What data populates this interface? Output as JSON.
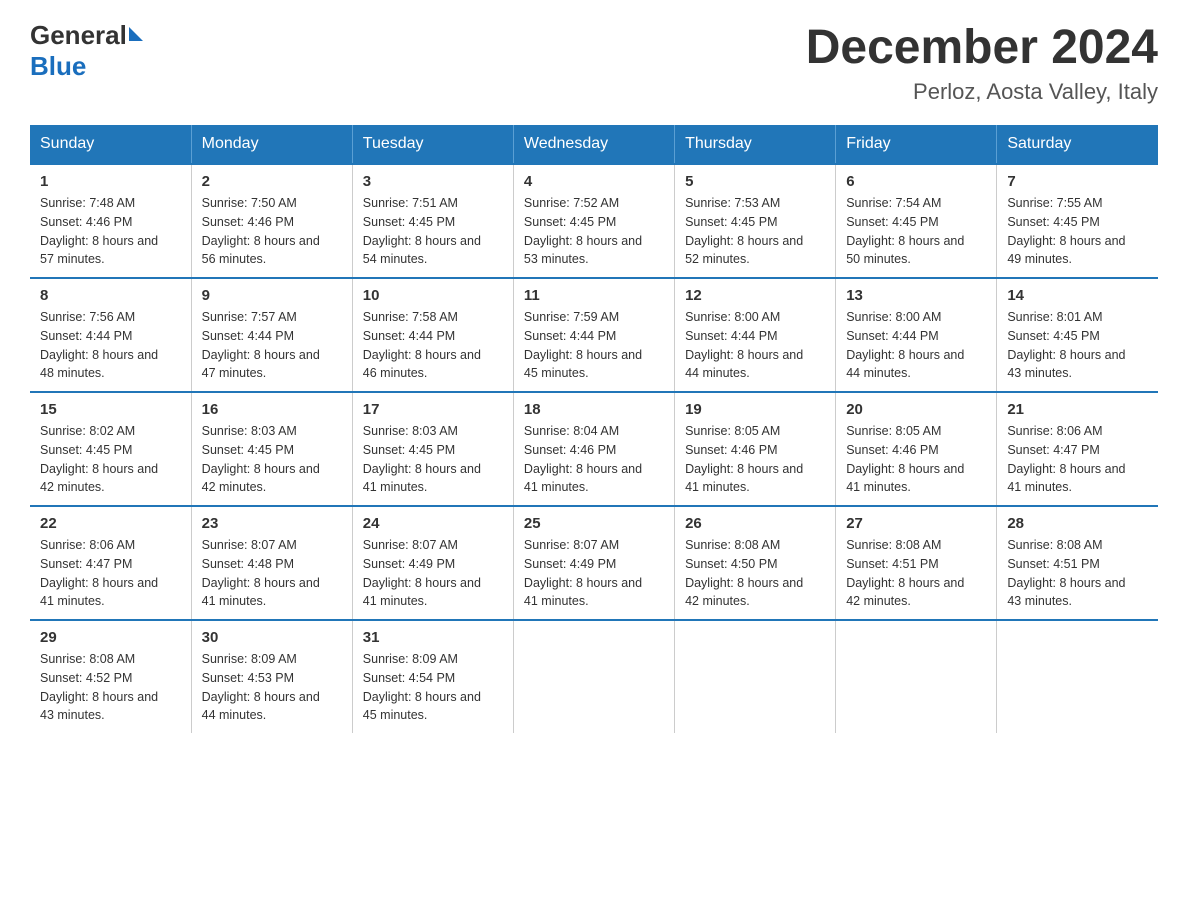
{
  "header": {
    "logo_general": "General",
    "logo_blue": "Blue",
    "month_title": "December 2024",
    "location": "Perloz, Aosta Valley, Italy"
  },
  "days_of_week": [
    "Sunday",
    "Monday",
    "Tuesday",
    "Wednesday",
    "Thursday",
    "Friday",
    "Saturday"
  ],
  "weeks": [
    [
      {
        "day": "1",
        "sunrise": "7:48 AM",
        "sunset": "4:46 PM",
        "daylight": "8 hours and 57 minutes."
      },
      {
        "day": "2",
        "sunrise": "7:50 AM",
        "sunset": "4:46 PM",
        "daylight": "8 hours and 56 minutes."
      },
      {
        "day": "3",
        "sunrise": "7:51 AM",
        "sunset": "4:45 PM",
        "daylight": "8 hours and 54 minutes."
      },
      {
        "day": "4",
        "sunrise": "7:52 AM",
        "sunset": "4:45 PM",
        "daylight": "8 hours and 53 minutes."
      },
      {
        "day": "5",
        "sunrise": "7:53 AM",
        "sunset": "4:45 PM",
        "daylight": "8 hours and 52 minutes."
      },
      {
        "day": "6",
        "sunrise": "7:54 AM",
        "sunset": "4:45 PM",
        "daylight": "8 hours and 50 minutes."
      },
      {
        "day": "7",
        "sunrise": "7:55 AM",
        "sunset": "4:45 PM",
        "daylight": "8 hours and 49 minutes."
      }
    ],
    [
      {
        "day": "8",
        "sunrise": "7:56 AM",
        "sunset": "4:44 PM",
        "daylight": "8 hours and 48 minutes."
      },
      {
        "day": "9",
        "sunrise": "7:57 AM",
        "sunset": "4:44 PM",
        "daylight": "8 hours and 47 minutes."
      },
      {
        "day": "10",
        "sunrise": "7:58 AM",
        "sunset": "4:44 PM",
        "daylight": "8 hours and 46 minutes."
      },
      {
        "day": "11",
        "sunrise": "7:59 AM",
        "sunset": "4:44 PM",
        "daylight": "8 hours and 45 minutes."
      },
      {
        "day": "12",
        "sunrise": "8:00 AM",
        "sunset": "4:44 PM",
        "daylight": "8 hours and 44 minutes."
      },
      {
        "day": "13",
        "sunrise": "8:00 AM",
        "sunset": "4:44 PM",
        "daylight": "8 hours and 44 minutes."
      },
      {
        "day": "14",
        "sunrise": "8:01 AM",
        "sunset": "4:45 PM",
        "daylight": "8 hours and 43 minutes."
      }
    ],
    [
      {
        "day": "15",
        "sunrise": "8:02 AM",
        "sunset": "4:45 PM",
        "daylight": "8 hours and 42 minutes."
      },
      {
        "day": "16",
        "sunrise": "8:03 AM",
        "sunset": "4:45 PM",
        "daylight": "8 hours and 42 minutes."
      },
      {
        "day": "17",
        "sunrise": "8:03 AM",
        "sunset": "4:45 PM",
        "daylight": "8 hours and 41 minutes."
      },
      {
        "day": "18",
        "sunrise": "8:04 AM",
        "sunset": "4:46 PM",
        "daylight": "8 hours and 41 minutes."
      },
      {
        "day": "19",
        "sunrise": "8:05 AM",
        "sunset": "4:46 PM",
        "daylight": "8 hours and 41 minutes."
      },
      {
        "day": "20",
        "sunrise": "8:05 AM",
        "sunset": "4:46 PM",
        "daylight": "8 hours and 41 minutes."
      },
      {
        "day": "21",
        "sunrise": "8:06 AM",
        "sunset": "4:47 PM",
        "daylight": "8 hours and 41 minutes."
      }
    ],
    [
      {
        "day": "22",
        "sunrise": "8:06 AM",
        "sunset": "4:47 PM",
        "daylight": "8 hours and 41 minutes."
      },
      {
        "day": "23",
        "sunrise": "8:07 AM",
        "sunset": "4:48 PM",
        "daylight": "8 hours and 41 minutes."
      },
      {
        "day": "24",
        "sunrise": "8:07 AM",
        "sunset": "4:49 PM",
        "daylight": "8 hours and 41 minutes."
      },
      {
        "day": "25",
        "sunrise": "8:07 AM",
        "sunset": "4:49 PM",
        "daylight": "8 hours and 41 minutes."
      },
      {
        "day": "26",
        "sunrise": "8:08 AM",
        "sunset": "4:50 PM",
        "daylight": "8 hours and 42 minutes."
      },
      {
        "day": "27",
        "sunrise": "8:08 AM",
        "sunset": "4:51 PM",
        "daylight": "8 hours and 42 minutes."
      },
      {
        "day": "28",
        "sunrise": "8:08 AM",
        "sunset": "4:51 PM",
        "daylight": "8 hours and 43 minutes."
      }
    ],
    [
      {
        "day": "29",
        "sunrise": "8:08 AM",
        "sunset": "4:52 PM",
        "daylight": "8 hours and 43 minutes."
      },
      {
        "day": "30",
        "sunrise": "8:09 AM",
        "sunset": "4:53 PM",
        "daylight": "8 hours and 44 minutes."
      },
      {
        "day": "31",
        "sunrise": "8:09 AM",
        "sunset": "4:54 PM",
        "daylight": "8 hours and 45 minutes."
      },
      null,
      null,
      null,
      null
    ]
  ]
}
